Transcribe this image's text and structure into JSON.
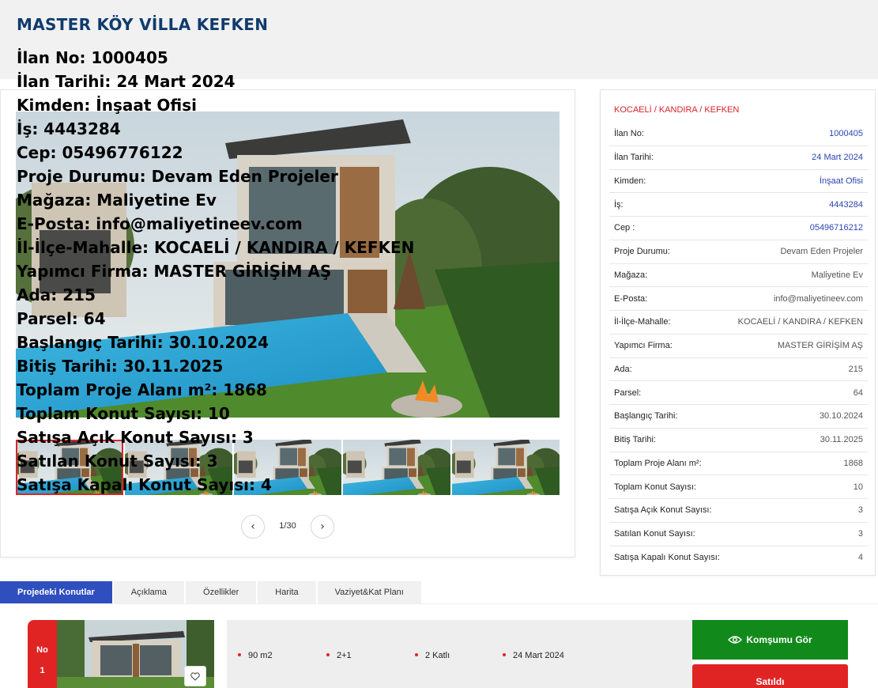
{
  "page": {
    "title": "MASTER KÖY VİLLA KEFKEN"
  },
  "overlay_lines": [
    "İlan No: 1000405",
    "İlan Tarihi: 24 Mart 2024",
    "Kimden: İnşaat Ofisi",
    "İş: 4443284",
    "Cep: 05496776122",
    "Proje Durumu: Devam Eden Projeler",
    "Mağaza: Maliyetine Ev",
    "E-Posta: info@maliyetineev.com",
    "İl-İlçe-Mahalle: KOCAELİ / KANDIRA / KEFKEN",
    "Yapımcı Firma: MASTER GİRİŞİM AŞ",
    "Ada: 215",
    "Parsel: 64",
    "Başlangıç Tarihi: 30.10.2024",
    "Bitiş Tarihi: 30.11.2025",
    "Toplam Proje Alanı m²: 1868",
    "Toplam Konut Sayısı: 10",
    "Satışa Açık Konut Sayısı: 3",
    "Satılan Konut Sayısı: 3",
    "Satışa Kapalı Konut Sayısı: 4"
  ],
  "gallery": {
    "pager_text": "1/30",
    "prev_icon": "chevron-left-icon",
    "next_icon": "chevron-right-icon",
    "thumbnail_count": 5,
    "active_thumbnail": 1
  },
  "info": {
    "location": "KOCAELİ / KANDIRA / KEFKEN",
    "rows": [
      {
        "label": "İlan No:",
        "value": "1000405",
        "link": true
      },
      {
        "label": "İlan Tarihi:",
        "value": "24 Mart 2024",
        "link": true
      },
      {
        "label": "Kimden:",
        "value": "İnşaat Ofisi",
        "link": true
      },
      {
        "label": "İş:",
        "value": "4443284",
        "link": true
      },
      {
        "label": "Cep :",
        "value": "05496716212",
        "link": true
      },
      {
        "label": "Proje Durumu:",
        "value": "Devam Eden Projeler",
        "link": false
      },
      {
        "label": "Mağaza:",
        "value": "Maliyetine Ev",
        "link": false
      },
      {
        "label": "E-Posta:",
        "value": "info@maliyetineev.com",
        "link": false
      },
      {
        "label": "İl-İlçe-Mahalle:",
        "value": "KOCAELİ / KANDIRA / KEFKEN",
        "link": false
      },
      {
        "label": "Yapımcı Firma:",
        "value": "MASTER GİRİŞİM AŞ",
        "link": false
      },
      {
        "label": "Ada:",
        "value": "215",
        "link": false
      },
      {
        "label": "Parsel:",
        "value": "64",
        "link": false
      },
      {
        "label": "Başlangıç Tarihi:",
        "value": "30.10.2024",
        "link": false
      },
      {
        "label": "Bitiş Tarihi:",
        "value": "30.11.2025",
        "link": false
      },
      {
        "label": "Toplam Proje Alanı m²:",
        "value": "1868",
        "link": false
      },
      {
        "label": "Toplam Konut Sayısı:",
        "value": "10",
        "link": false
      },
      {
        "label": "Satışa Açık Konut Sayısı:",
        "value": "3",
        "link": false
      },
      {
        "label": "Satılan Konut Sayısı:",
        "value": "3",
        "link": false
      },
      {
        "label": "Satışa Kapalı Konut Sayısı:",
        "value": "4",
        "link": false
      }
    ]
  },
  "tabs": [
    {
      "label": "Projedeki Konutlar",
      "active": true
    },
    {
      "label": "Açıklama",
      "active": false
    },
    {
      "label": "Özellikler",
      "active": false
    },
    {
      "label": "Harita",
      "active": false
    },
    {
      "label": "Vaziyet&Kat Planı",
      "active": false
    }
  ],
  "listing": {
    "no_label": "No",
    "no_value": "1",
    "area": "90 m2",
    "rooms": "2+1",
    "floors": "2 Katlı",
    "date": "24 Mart 2024",
    "neighbor_button": "Komşumu Gör",
    "neighbor_icon": "eye-icon",
    "status_button": "Satıldı",
    "favorite_icon": "heart-icon"
  },
  "colors": {
    "title": "#103b6e",
    "accent_red": "#e02424",
    "link_blue": "#2a45b0",
    "tab_active": "#2f4fbf",
    "button_green": "#118a1b"
  }
}
